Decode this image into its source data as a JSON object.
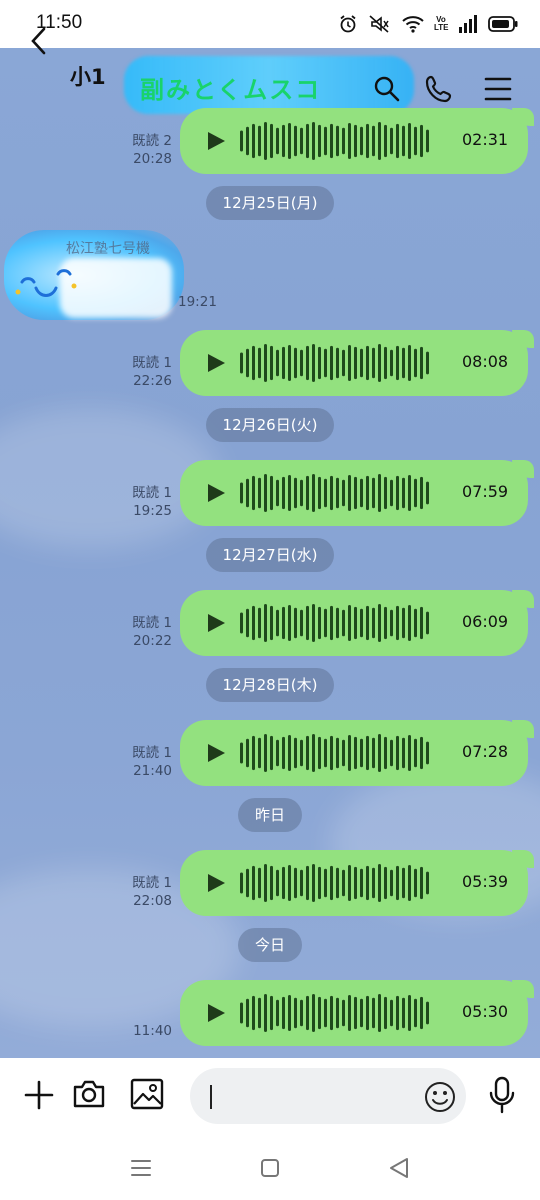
{
  "status_bar": {
    "time": "11:50",
    "volte_label": "Vo LTE",
    "icons": [
      "alarm-icon",
      "mute-icon",
      "wifi-icon",
      "signal-icon",
      "battery-icon"
    ]
  },
  "header": {
    "chat_name": "小1",
    "title_text": "副みとくムスコ",
    "icons": [
      "back-icon",
      "search-icon",
      "phone-icon",
      "menu-icon"
    ]
  },
  "messages": [
    {
      "read": "既読 2",
      "time": "20:28",
      "duration": "02:31"
    },
    {
      "read": "既読 1",
      "time": "22:26",
      "duration": "08:08"
    },
    {
      "read": "既読 1",
      "time": "19:25",
      "duration": "07:59"
    },
    {
      "read": "既読 1",
      "time": "20:22",
      "duration": "06:09"
    },
    {
      "read": "既読 1",
      "time": "21:40",
      "duration": "07:28"
    },
    {
      "read": "既読 1",
      "time": "22:08",
      "duration": "05:39"
    },
    {
      "read": "",
      "time": "11:40",
      "duration": "05:30"
    }
  ],
  "dates": [
    "12月25日(月)",
    "12月26日(火)",
    "12月27日(水)",
    "12月28日(木)",
    "昨日",
    "今日"
  ],
  "incoming": {
    "sender": "松江塾七号機",
    "time": "19:21"
  },
  "input": {
    "placeholder": ""
  },
  "colors": {
    "bubble": "#93e17f",
    "chat_background": "#8aa7d6",
    "date_pill": "#6f84a9"
  }
}
